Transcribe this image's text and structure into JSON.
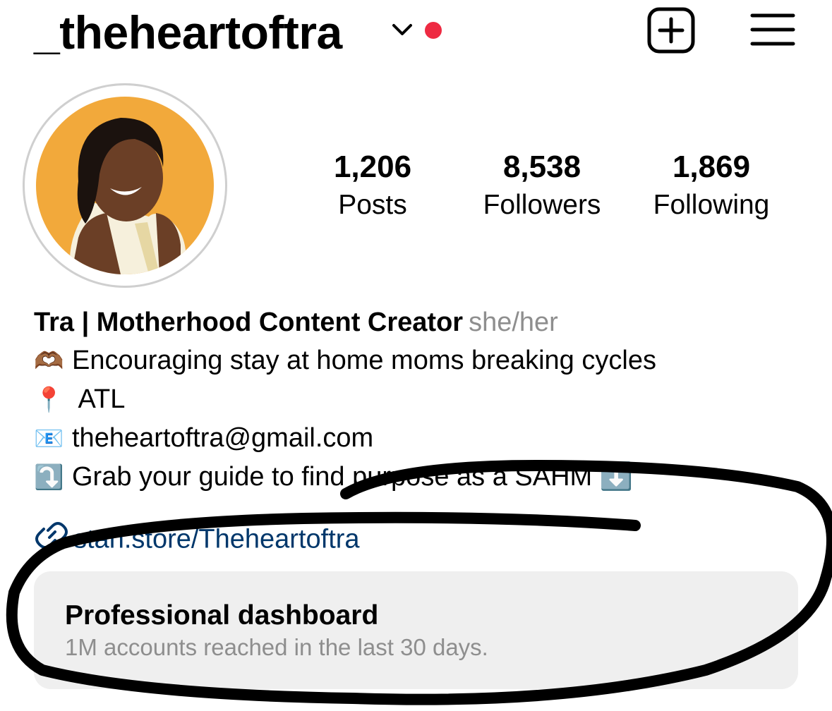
{
  "header": {
    "username": "_theheartoftra",
    "account_switch_icon": "chevron-down-icon",
    "notification_color": "#ee2a42",
    "create_icon": "plus-square-icon",
    "menu_icon": "hamburger-menu-icon"
  },
  "stats": [
    {
      "value": "1,206",
      "label": "Posts"
    },
    {
      "value": "8,538",
      "label": "Followers"
    },
    {
      "value": "1,869",
      "label": "Following"
    }
  ],
  "bio": {
    "display_name": "Tra | Motherhood Content Creator",
    "pronouns": "she/her",
    "lines": [
      {
        "emoji": "🫶🏾",
        "text": "Encouraging stay at home moms breaking cycles"
      },
      {
        "emoji": "📍",
        "text": " ATL"
      },
      {
        "emoji": "📧",
        "text": "theheartoftra@gmail.com"
      },
      {
        "emoji": "⤵️",
        "text": "Grab your guide to find purpose as a SAHM ⬇️"
      }
    ],
    "link_icon": "link-icon",
    "link": "stan.store/Theheartoftra"
  },
  "dashboard": {
    "title": "Professional dashboard",
    "subtitle": "1M accounts reached in the last 30 days."
  },
  "colors": {
    "link": "#00376b",
    "secondary_text": "#8e8e8e",
    "card_bg": "#efefef"
  }
}
